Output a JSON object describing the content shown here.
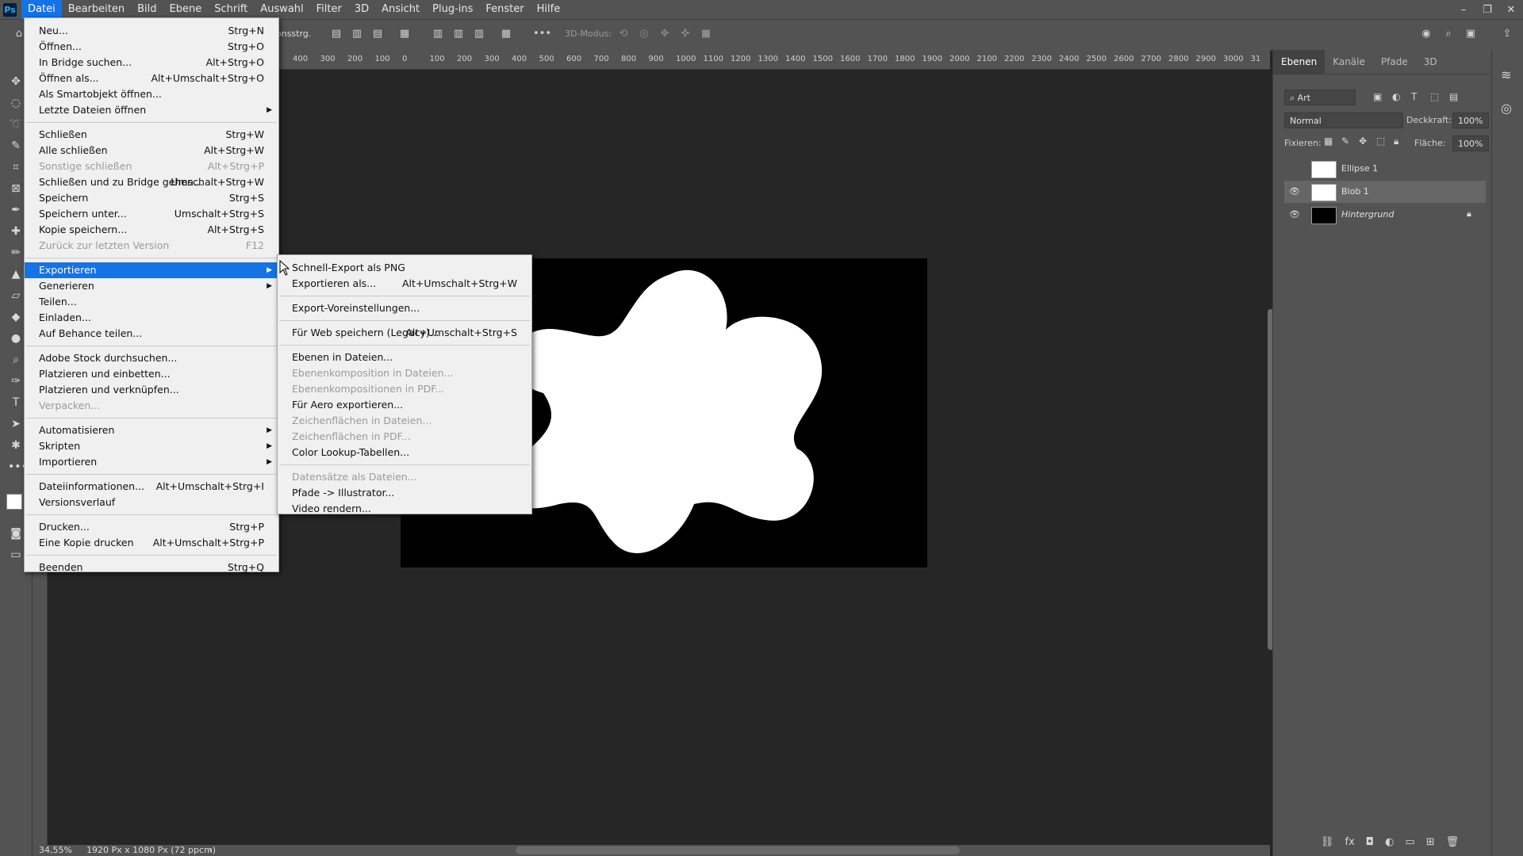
{
  "menubar": {
    "logo": "Ps",
    "items": [
      "Datei",
      "Bearbeiten",
      "Bild",
      "Ebene",
      "Schrift",
      "Auswahl",
      "Filter",
      "3D",
      "Ansicht",
      "Plug-ins",
      "Fenster",
      "Hilfe"
    ],
    "active_index": 0
  },
  "options_bar": {
    "fragment": "onsstrg.",
    "mode_label": "3D-Modus:"
  },
  "ruler": {
    "labels": [
      "400",
      "300",
      "200",
      "100",
      "0",
      "100",
      "200",
      "300",
      "400",
      "500",
      "600",
      "700",
      "800",
      "900",
      "1000",
      "1100",
      "1200",
      "1300",
      "1400",
      "1500",
      "1600",
      "1700",
      "1800",
      "1900",
      "2000",
      "2100",
      "2200",
      "2300",
      "2400",
      "2500",
      "2600",
      "2700",
      "2800",
      "2900",
      "3000",
      "31"
    ]
  },
  "status": {
    "zoom": "34,55%",
    "doc_info": "1920 Px x 1080 Px (72 ppcm)"
  },
  "panel": {
    "tabs": [
      "Ebenen",
      "Kanäle",
      "Pfade",
      "3D"
    ],
    "filter": "Art",
    "blend_mode": "Normal",
    "opacity_label": "Deckkraft:",
    "opacity_value": "100%",
    "lock_label": "Fixieren:",
    "fill_label": "Fläche:",
    "fill_value": "100%",
    "layers": [
      {
        "name": "Ellipse 1",
        "visible": false,
        "selected": false
      },
      {
        "name": "Blob 1",
        "visible": true,
        "selected": true
      },
      {
        "name": "Hintergrund",
        "visible": true,
        "selected": false,
        "locked": true
      }
    ]
  },
  "file_menu": {
    "items": [
      {
        "label": "Neu...",
        "shortcut": "Strg+N"
      },
      {
        "label": "Öffnen...",
        "shortcut": "Strg+O"
      },
      {
        "label": "In Bridge suchen...",
        "shortcut": "Alt+Strg+O"
      },
      {
        "label": "Öffnen als...",
        "shortcut": "Alt+Umschalt+Strg+O"
      },
      {
        "label": "Als Smartobjekt öffnen...",
        "shortcut": ""
      },
      {
        "label": "Letzte Dateien öffnen",
        "shortcut": "",
        "submenu": true
      },
      {
        "label": "Schließen",
        "shortcut": "Strg+W"
      },
      {
        "label": "Alle schließen",
        "shortcut": "Alt+Strg+W"
      },
      {
        "label": "Sonstige schließen",
        "shortcut": "Alt+Strg+P",
        "disabled": true
      },
      {
        "label": "Schließen und zu Bridge gehen...",
        "shortcut": "Umschalt+Strg+W"
      },
      {
        "label": "Speichern",
        "shortcut": "Strg+S"
      },
      {
        "label": "Speichern unter...",
        "shortcut": "Umschalt+Strg+S"
      },
      {
        "label": "Kopie speichern...",
        "shortcut": "Alt+Strg+S"
      },
      {
        "label": "Zurück zur letzten Version",
        "shortcut": "F12",
        "disabled": true
      },
      {
        "label": "Exportieren",
        "shortcut": "",
        "submenu": true,
        "highlight": true
      },
      {
        "label": "Generieren",
        "shortcut": "",
        "submenu": true
      },
      {
        "label": "Teilen...",
        "shortcut": ""
      },
      {
        "label": "Einladen...",
        "shortcut": ""
      },
      {
        "label": "Auf Behance teilen...",
        "shortcut": ""
      },
      {
        "label": "Adobe Stock durchsuchen...",
        "shortcut": ""
      },
      {
        "label": "Platzieren und einbetten...",
        "shortcut": ""
      },
      {
        "label": "Platzieren und verknüpfen...",
        "shortcut": ""
      },
      {
        "label": "Verpacken...",
        "shortcut": "",
        "disabled": true
      },
      {
        "label": "Automatisieren",
        "shortcut": "",
        "submenu": true
      },
      {
        "label": "Skripten",
        "shortcut": "",
        "submenu": true
      },
      {
        "label": "Importieren",
        "shortcut": "",
        "submenu": true
      },
      {
        "label": "Dateiinformationen...",
        "shortcut": "Alt+Umschalt+Strg+I"
      },
      {
        "label": "Versionsverlauf",
        "shortcut": ""
      },
      {
        "label": "Drucken...",
        "shortcut": "Strg+P"
      },
      {
        "label": "Eine Kopie drucken",
        "shortcut": "Alt+Umschalt+Strg+P"
      },
      {
        "label": "Beenden",
        "shortcut": "Strg+Q"
      }
    ]
  },
  "export_menu": {
    "items": [
      {
        "label": "Schnell-Export als PNG",
        "shortcut": ""
      },
      {
        "label": "Exportieren als...",
        "shortcut": "Alt+Umschalt+Strg+W"
      },
      {
        "label": "Export-Voreinstellungen...",
        "shortcut": ""
      },
      {
        "label": "Für Web speichern (Legacy)...",
        "shortcut": "Alt+Umschalt+Strg+S"
      },
      {
        "label": "Ebenen in Dateien...",
        "shortcut": ""
      },
      {
        "label": "Ebenenkomposition in Dateien...",
        "shortcut": "",
        "disabled": true
      },
      {
        "label": "Ebenenkompositionen in PDF...",
        "shortcut": "",
        "disabled": true
      },
      {
        "label": "Für Aero exportieren...",
        "shortcut": ""
      },
      {
        "label": "Zeichenflächen in Dateien...",
        "shortcut": "",
        "disabled": true
      },
      {
        "label": "Zeichenflächen in PDF...",
        "shortcut": "",
        "disabled": true
      },
      {
        "label": "Color Lookup-Tabellen...",
        "shortcut": ""
      },
      {
        "label": "Datensätze als Dateien...",
        "shortcut": "",
        "disabled": true
      },
      {
        "label": "Pfade -> Illustrator...",
        "shortcut": ""
      },
      {
        "label": "Video rendern...",
        "shortcut": ""
      }
    ]
  },
  "colors": {
    "accent": "#1473e6",
    "ui_gray": "#535353",
    "workspace": "#262626"
  }
}
